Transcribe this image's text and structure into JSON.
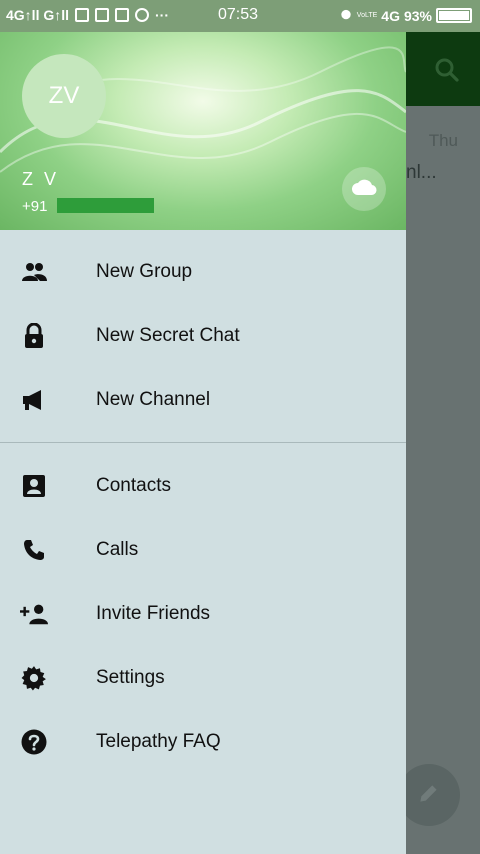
{
  "status_bar": {
    "left_text": "4G↑ll G↑ll",
    "dots": "···",
    "time": "07:53",
    "network_small": "VoLTE",
    "network": "4G",
    "battery": "93%",
    "battery_level": 0.93
  },
  "drawer": {
    "avatar_initials": "ZV",
    "user_name": "Z V",
    "user_phone": "+91"
  },
  "menu": {
    "items": [
      {
        "label": "New Group"
      },
      {
        "label": "New Secret Chat"
      },
      {
        "label": "New Channel"
      },
      {
        "label": "Contacts"
      },
      {
        "label": "Calls"
      },
      {
        "label": "Invite Friends"
      },
      {
        "label": "Settings"
      },
      {
        "label": "Telepathy FAQ"
      }
    ]
  },
  "background": {
    "day": "Thu",
    "snippet": "nl..."
  },
  "colors": {
    "header_dark": "#0d3a10",
    "drawer_bg": "#d0dfe1",
    "redaction": "#2e9d3a"
  },
  "icons": [
    "group-icon",
    "lock-icon",
    "megaphone-icon",
    "contact-card-icon",
    "phone-icon",
    "add-person-icon",
    "gear-icon",
    "help-icon",
    "cloud-icon",
    "search-icon",
    "pencil-icon"
  ]
}
